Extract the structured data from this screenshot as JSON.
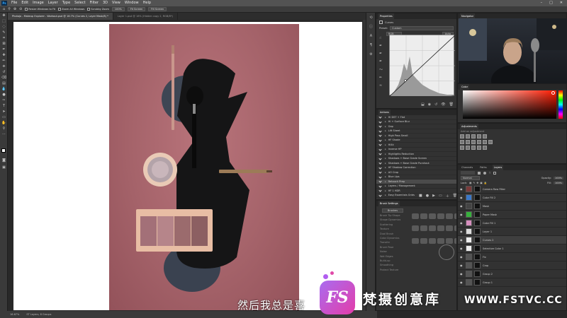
{
  "menu": {
    "app_badge": "Ps",
    "items": [
      "File",
      "Edit",
      "Image",
      "Layer",
      "Type",
      "Select",
      "Filter",
      "3D",
      "View",
      "Window",
      "Help"
    ],
    "window_controls": [
      "–",
      "□",
      "✕"
    ]
  },
  "options_bar": {
    "buttons": [
      "Resize Windows to Fit",
      "Zoom All Windows",
      "Scrubby Zoom",
      "100%",
      "Fit Screen",
      "Fill Screen"
    ]
  },
  "document_tabs": [
    {
      "label": "Photojo - Makeup Explorer - Workout.psd @ 16.7% (Curves 2, Layer Mask/8) *",
      "active": true
    },
    {
      "label": "Layer 1.psd @ 16% (Hidden copy 2, RGB/8*)",
      "active": false
    }
  ],
  "status": {
    "zoom": "16.67%",
    "info": "ST Layers, 8 Groups"
  },
  "properties": {
    "tabs": [
      "Properties"
    ],
    "section": "Curves",
    "preset_label": "Preset:",
    "preset_value": "Custom",
    "channel_value": "RGB",
    "auto_label": "Auto"
  },
  "actions": {
    "tab": "Actions",
    "items": [
      "Hi DST + Flat",
      "Hi + Surface Blur",
      "Gap",
      "Lift Sheet",
      "High Pass Small",
      "HF Shade",
      "HI4k",
      "Inverse HP",
      "Highlights Reduction",
      "Shadows + Base Grade Screen",
      "Shadows + Base Grade Purahaut",
      "HF Shadow Correction",
      "AO Crop",
      "Blue Lips",
      "Retouch Prep",
      "Layers / Management",
      "HF 1 HDR",
      "Easy Essentials Grids"
    ],
    "selected_index": 14
  },
  "brush": {
    "tabs": [
      "Brush Settings"
    ],
    "button": "Brushes",
    "options": [
      "Brush Tip Shape",
      "Shape Dynamics",
      "Scattering",
      "Texture",
      "Dual Brush",
      "Color Dynamics",
      "Transfer",
      "Brush Pose",
      "Noise",
      "Wet Edges",
      "Build-up",
      "Smoothing",
      "Protect Texture"
    ]
  },
  "navigator": {
    "tab": "Navigator"
  },
  "color": {
    "tab": "Color",
    "accent": "#ff1a00"
  },
  "adjustments": {
    "tab": "Adjustments",
    "hint": "Add an adjustment"
  },
  "layers": {
    "tabs": [
      "Channels",
      "Paths",
      "Layers"
    ],
    "blend_mode": "Normal",
    "opacity_label": "Opacity:",
    "opacity": "100%",
    "lock_label": "Lock:",
    "fill_label": "Fill:",
    "fill": "100%",
    "items": [
      {
        "name": "Camera Raw Filter",
        "color": "#7a3a3a"
      },
      {
        "name": "Color Fill 2",
        "color": "#3b78c8"
      },
      {
        "name": "Mask",
        "color": "#444"
      },
      {
        "name": "Paper Mask",
        "color": "#37b13d"
      },
      {
        "name": "Color Fill 1",
        "color": "#d78fbf"
      },
      {
        "name": "Layer 1",
        "color": "#ddd"
      },
      {
        "name": "Curves 2",
        "color": "#eee"
      },
      {
        "name": "Selective Color 1",
        "color": "#eee"
      },
      {
        "name": "Fix",
        "color": "#555"
      },
      {
        "name": "Crop",
        "color": "#555"
      },
      {
        "name": "Group 2",
        "color": "#555"
      },
      {
        "name": "Group 1",
        "color": "#555"
      }
    ],
    "selected_index": 6
  },
  "subtitle": "然后我总是喜",
  "watermark": {
    "logo": "FS",
    "text": "梵摄创意库",
    "url": "WWW.FSTVC.CC"
  }
}
